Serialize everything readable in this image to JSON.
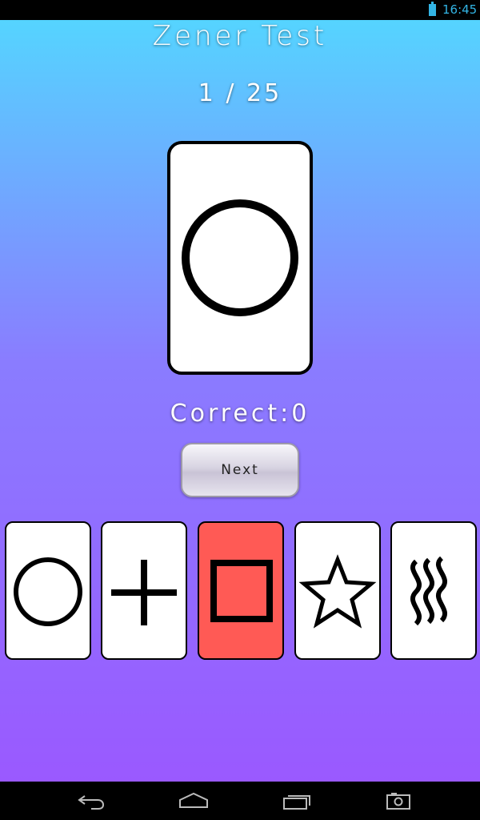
{
  "status_bar": {
    "time": "16:45"
  },
  "app": {
    "title": "Zener Test",
    "progress": "1 / 25",
    "current_card_symbol": "circle-icon",
    "correct_text": "Correct:0",
    "next_label": "Next"
  },
  "choices": [
    {
      "symbol": "circle-icon",
      "selected": false
    },
    {
      "symbol": "plus-icon",
      "selected": false
    },
    {
      "symbol": "square-icon",
      "selected": true
    },
    {
      "symbol": "star-icon",
      "selected": false
    },
    {
      "symbol": "waves-icon",
      "selected": false
    }
  ],
  "colors": {
    "gradient_top": "#55d4ff",
    "gradient_bottom": "#9a59ff",
    "selected_card": "#ff5a55",
    "status_accent": "#33b5e5"
  },
  "nav_bar": [
    "back-icon",
    "home-icon",
    "recent-apps-icon",
    "screenshot-icon"
  ]
}
